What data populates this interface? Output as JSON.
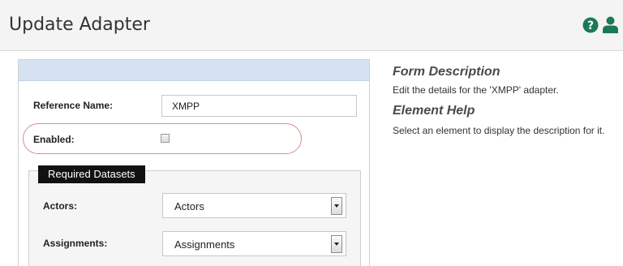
{
  "header": {
    "title": "Update Adapter",
    "help_icon": "question-circle-icon",
    "user_icon": "user-icon",
    "accent_color": "#1a7a55"
  },
  "form": {
    "reference_name_label": "Reference Name:",
    "reference_name_value": "XMPP",
    "enabled_label": "Enabled:",
    "enabled_checked": false,
    "required_datasets_legend": "Required Datasets",
    "actors_label": "Actors:",
    "actors_value": "Actors",
    "assignments_label": "Assignments:",
    "assignments_value": "Assignments",
    "highlight_color": "#e08a8a"
  },
  "side": {
    "form_description_title": "Form Description",
    "form_description_text": "Edit the details for the 'XMPP' adapter.",
    "element_help_title": "Element Help",
    "element_help_text": "Select an element to display the description for it."
  }
}
